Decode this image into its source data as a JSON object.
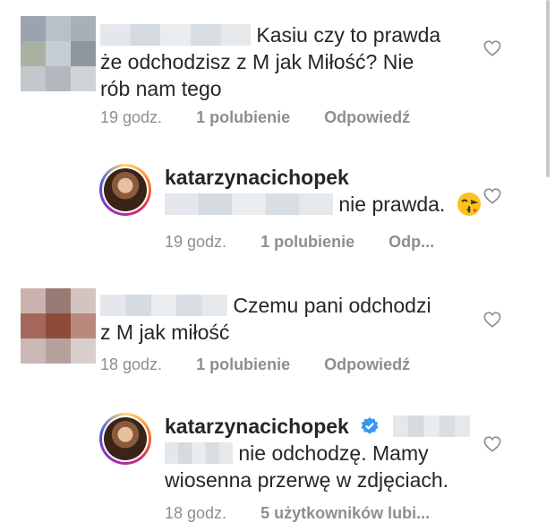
{
  "comments": [
    {
      "text_line1": "Kasiu czy to prawda",
      "text_line2": "że odchodzisz z M jak Miłość?  Nie",
      "text_line3": "rób nam tego",
      "time": "19 godz.",
      "likes": "1 polubienie",
      "reply": "Odpowiedź"
    },
    {
      "username": "katarzynacichopek",
      "text_line1": "nie prawda.",
      "time": "19 godz.",
      "likes": "1 polubienie",
      "reply": "Odp..."
    },
    {
      "text_line1": "Czemu pani odchodzi",
      "text_line2": "z M jak miłość",
      "time": "18 godz.",
      "likes": "1 polubienie",
      "reply": "Odpowiedź"
    },
    {
      "username": "katarzynacichopek",
      "text_line1": "nie odchodzę. Mamy",
      "text_line2": "wiosenna przerwę w zdjęciach.",
      "time": "18 godz.",
      "likes": "5 użytkowników lubi..."
    }
  ],
  "icons": {
    "heart": "heart-icon",
    "verified": "verified-badge-icon",
    "emoji": "kiss-emoji-icon"
  }
}
